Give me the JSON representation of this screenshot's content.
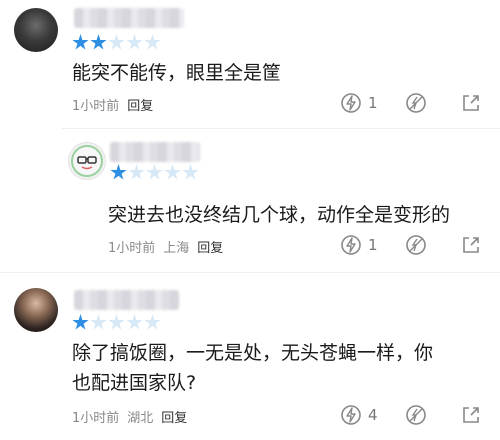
{
  "comments": [
    {
      "stars_on": 2,
      "stars_total": 5,
      "text": "能突不能传，眼里全是筐",
      "meta": {
        "time": "1小时前",
        "location": "",
        "reply": "回复"
      },
      "likes": "1"
    },
    {
      "stars_on": 1,
      "stars_total": 5,
      "text": "突进去也没终结几个球，动作全是变形的",
      "meta": {
        "time": "1小时前",
        "location": "上海",
        "reply": "回复"
      },
      "likes": "1"
    },
    {
      "stars_on": 1,
      "stars_total": 5,
      "text": "除了搞饭圈，一无是处，无头苍蝇一样，你\n也配进国家队?",
      "meta": {
        "time": "1小时前",
        "location": "湖北",
        "reply": "回复"
      },
      "likes": "4"
    }
  ],
  "colors": {
    "star_on": "#2d8fe3",
    "star_off": "#d7e8f6",
    "meta": "#8a8a8a"
  },
  "icons": {
    "like": "lightning-like-icon",
    "dislike": "dislike-icon",
    "share": "share-icon"
  }
}
